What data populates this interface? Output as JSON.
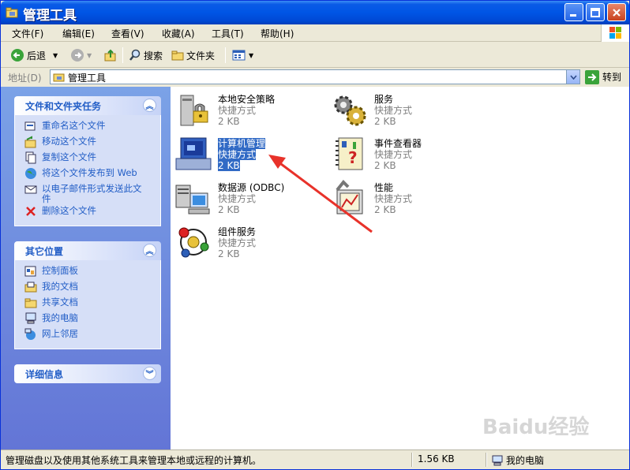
{
  "window": {
    "title": "管理工具"
  },
  "menu": [
    "文件(F)",
    "编辑(E)",
    "查看(V)",
    "收藏(A)",
    "工具(T)",
    "帮助(H)"
  ],
  "toolbar": {
    "back": "后退",
    "search": "搜索",
    "folders": "文件夹"
  },
  "address": {
    "label": "地址(D)",
    "value": "管理工具",
    "go": "转到"
  },
  "tasks": {
    "title": "文件和文件夹任务",
    "items": [
      "重命名这个文件",
      "移动这个文件",
      "复制这个文件",
      "将这个文件发布到 Web",
      "以电子邮件形式发送此文件",
      "删除这个文件"
    ]
  },
  "places": {
    "title": "其它位置",
    "items": [
      "控制面板",
      "我的文档",
      "共享文档",
      "我的电脑",
      "网上邻居"
    ]
  },
  "details": {
    "title": "详细信息"
  },
  "files": [
    {
      "name": "本地安全策略",
      "type": "快捷方式",
      "size": "2 KB",
      "icon": "security-policy-icon"
    },
    {
      "name": "服务",
      "type": "快捷方式",
      "size": "2 KB",
      "icon": "services-gears-icon"
    },
    {
      "name": "计算机管理",
      "type": "快捷方式",
      "size": "2 KB",
      "icon": "computer-management-icon",
      "selected": true
    },
    {
      "name": "事件查看器",
      "type": "快捷方式",
      "size": "2 KB",
      "icon": "event-viewer-icon"
    },
    {
      "name": "数据源 (ODBC)",
      "type": "快捷方式",
      "size": "2 KB",
      "icon": "odbc-icon"
    },
    {
      "name": "性能",
      "type": "快捷方式",
      "size": "2 KB",
      "icon": "performance-icon"
    },
    {
      "name": "组件服务",
      "type": "快捷方式",
      "size": "2 KB",
      "icon": "component-services-icon"
    }
  ],
  "status": {
    "text": "管理磁盘以及使用其他系统工具来管理本地或远程的计算机。",
    "size": "1.56 KB",
    "zone": "我的电脑"
  },
  "watermark": "Baidu经验"
}
